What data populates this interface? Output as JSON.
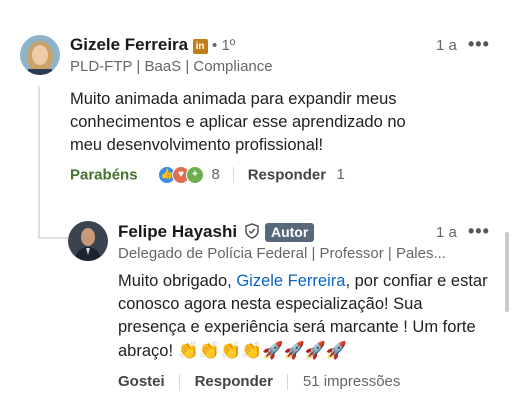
{
  "comment": {
    "author": "Gizele Ferreira",
    "badge_icon": "linkedin-icon",
    "badge_text": "in",
    "degree": "• 1º",
    "time": "1 a",
    "more_label": "•••",
    "headline": "PLD-FTP | BaaS | Compliance",
    "text": "Muito animada animada para expandir meus conhecimentos e aplicar esse aprendizado no meu desenvolvimento profissional!",
    "like_label": "Parabéns",
    "reaction_count": "8",
    "reply_label": "Responder",
    "reply_count": "1",
    "reaction_icons": [
      "like-icon",
      "love-icon",
      "celebrate-icon"
    ]
  },
  "reply": {
    "author": "Felipe Hayashi",
    "verified_icon": "verified-shield-icon",
    "author_badge": "Autor",
    "time": "1 a",
    "more_label": "•••",
    "headline": "Delegado de Polícia Federal | Professor | Pales...",
    "text_prefix": "Muito obrigado, ",
    "mention": "Gizele Ferreira",
    "text_rest": ", por confiar e estar conosco agora nesta especialização! Sua presença e experiência será marcante ! Um forte abraço! ",
    "emoji": "👏👏👏👏🚀🚀🚀🚀",
    "like_label": "Gostei",
    "reply_label": "Responder",
    "impressions": "51 impressões"
  },
  "colors": {
    "accent_green": "#44712e",
    "link_blue": "#0a66c2",
    "linkedin_gold": "#c37d16",
    "autor_badge": "#56687a"
  }
}
